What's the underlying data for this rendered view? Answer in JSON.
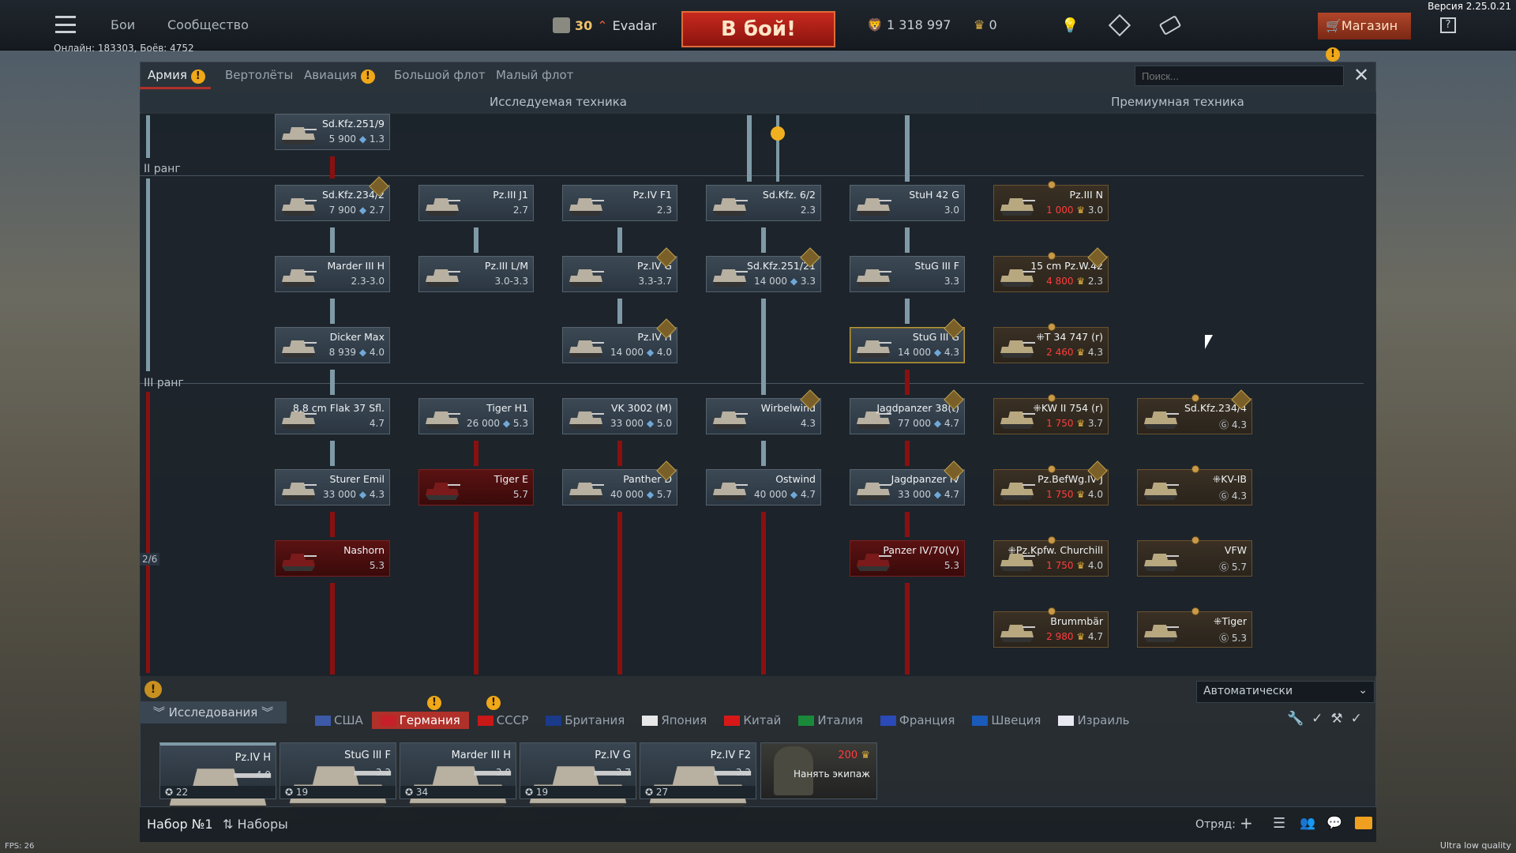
{
  "version": "Версия 2.25.0.21",
  "top_nav": {
    "battles": "Бои",
    "community": "Сообщество"
  },
  "player": {
    "level": "30",
    "name": "Evadar"
  },
  "fight_button": "В бой!",
  "currency": {
    "silver": "1 318 997",
    "gold": "0"
  },
  "shop": "Магазин",
  "online": "Онлайн: 183303, Боёв: 4752",
  "tabs": [
    "Армия",
    "Вертолёты",
    "Авиация",
    "Большой флот",
    "Малый флот"
  ],
  "search_placeholder": "Поиск...",
  "sections": {
    "researched": "Исследуемая техника",
    "premium": "Премиумная техника"
  },
  "ranks": {
    "r2": "II ранг",
    "r3": "III ранг",
    "page": "2/6"
  },
  "vehicles": [
    {
      "name": "Sd.Kfz.251/9",
      "cost": "5 900",
      "br": "1.3"
    },
    {
      "name": "Sd.Kfz.234/2",
      "cost": "7 900",
      "br": "2.7"
    },
    {
      "name": "Pz.III J1",
      "cost": "",
      "br": "2.7"
    },
    {
      "name": "Pz.IV F1",
      "cost": "",
      "br": "2.3"
    },
    {
      "name": "Sd.Kfz. 6/2",
      "cost": "",
      "br": "2.3"
    },
    {
      "name": "StuH 42 G",
      "cost": "",
      "br": "3.0"
    },
    {
      "name": "Marder III H",
      "cost": "",
      "br": "2.3-3.0"
    },
    {
      "name": "Pz.III L/M",
      "cost": "",
      "br": "3.0-3.3"
    },
    {
      "name": "Pz.IV G",
      "cost": "",
      "br": "3.3-3.7"
    },
    {
      "name": "Sd.Kfz.251/21",
      "cost": "14 000",
      "br": "3.3"
    },
    {
      "name": "StuG III F",
      "cost": "",
      "br": "3.3"
    },
    {
      "name": "Dicker Max",
      "cost": "8 939",
      "br": "4.0"
    },
    {
      "name": "Pz.IV H",
      "cost": "14 000",
      "br": "4.0"
    },
    {
      "name": "StuG III G",
      "cost": "14 000",
      "br": "4.3"
    },
    {
      "name": "8,8 cm Flak 37 Sfl.",
      "cost": "",
      "br": "4.7"
    },
    {
      "name": "Tiger H1",
      "cost": "26 000",
      "br": "5.3"
    },
    {
      "name": "VK 3002 (M)",
      "cost": "33 000",
      "br": "5.0"
    },
    {
      "name": "Wirbelwind",
      "cost": "",
      "br": "4.3"
    },
    {
      "name": "Jagdpanzer 38(t)",
      "cost": "77 000",
      "br": "4.7"
    },
    {
      "name": "Sturer Emil",
      "cost": "33 000",
      "br": "4.3"
    },
    {
      "name": "Tiger E",
      "cost": "",
      "br": "5.7"
    },
    {
      "name": "Panther D",
      "cost": "40 000",
      "br": "5.7"
    },
    {
      "name": "Ostwind",
      "cost": "40 000",
      "br": "4.7"
    },
    {
      "name": "Jagdpanzer IV",
      "cost": "33 000",
      "br": "4.7"
    },
    {
      "name": "Nashorn",
      "cost": "",
      "br": "5.3"
    },
    {
      "name": "Panzer IV/70(V)",
      "cost": "",
      "br": "5.3"
    }
  ],
  "premium": [
    {
      "name": "Pz.III N",
      "cost": "1 000",
      "br": "3.0"
    },
    {
      "name": "15 cm Pz.W.42",
      "cost": "4 800",
      "br": "2.3"
    },
    {
      "name": "⁜T 34 747 (r)",
      "cost": "2 460",
      "br": "4.3"
    },
    {
      "name": "⁜KW II 754 (r)",
      "cost": "1 750",
      "br": "3.7"
    },
    {
      "name": "Sd.Kfz.234/4",
      "cost": "",
      "br": "4.3"
    },
    {
      "name": "Pz.BefWg.IV J",
      "cost": "1 750",
      "br": "4.0"
    },
    {
      "name": "⁜KV-IB",
      "cost": "",
      "br": "4.3"
    },
    {
      "name": "⁜Pz.Kpfw. Churchill",
      "cost": "1 750",
      "br": "4.0"
    },
    {
      "name": "VFW",
      "cost": "",
      "br": "5.7"
    },
    {
      "name": "Brummbär",
      "cost": "2 980",
      "br": "4.7"
    },
    {
      "name": "⁜Tiger",
      "cost": "",
      "br": "5.3"
    }
  ],
  "auto_select": "Автоматически",
  "research_button": "Исследования",
  "nations": [
    "США",
    "Германия",
    "СССР",
    "Британия",
    "Япония",
    "Китай",
    "Италия",
    "Франция",
    "Швеция",
    "Израиль"
  ],
  "crew_slots": [
    {
      "name": "Pz.IV H",
      "br": "4.0",
      "crew": "22"
    },
    {
      "name": "StuG III F",
      "br": "3.3",
      "crew": "19"
    },
    {
      "name": "Marder III H",
      "br": "3.0",
      "crew": "34"
    },
    {
      "name": "Pz.IV G",
      "br": "3.7",
      "crew": "19"
    },
    {
      "name": "Pz.IV F2",
      "br": "3.3",
      "crew": "27"
    }
  ],
  "hire_crew": {
    "cost": "200",
    "label": "Нанять экипаж"
  },
  "preset": "Набор №1",
  "presets": "Наборы",
  "squad": "Отряд:",
  "fps": "FPS: 26",
  "quality": "Ultra low quality",
  "colors": {
    "accent_red": "#b0302a",
    "gold_cost": "#ff3d3d",
    "locked": "#5a1212"
  }
}
